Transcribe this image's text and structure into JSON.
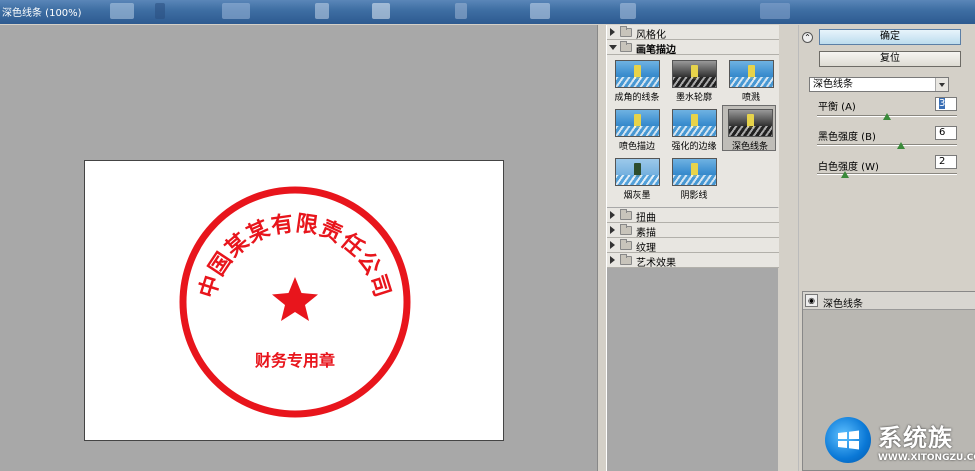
{
  "window": {
    "title": "深色线条 (100%)"
  },
  "gallery": {
    "categories_top": [
      {
        "label": "风格化",
        "expanded": false
      },
      {
        "label": "画笔描边",
        "expanded": true
      }
    ],
    "thumbnails": [
      {
        "label": "成角的线条",
        "selected": false
      },
      {
        "label": "墨水轮廓",
        "selected": false
      },
      {
        "label": "喷溅",
        "selected": false
      },
      {
        "label": "喷色描边",
        "selected": false
      },
      {
        "label": "强化的边缘",
        "selected": false
      },
      {
        "label": "深色线条",
        "selected": true
      },
      {
        "label": "烟灰墨",
        "selected": false
      },
      {
        "label": "阴影线",
        "selected": false
      }
    ],
    "categories_bottom": [
      {
        "label": "扭曲",
        "expanded": false
      },
      {
        "label": "素描",
        "expanded": false
      },
      {
        "label": "纹理",
        "expanded": false
      },
      {
        "label": "艺术效果",
        "expanded": false
      }
    ]
  },
  "panel": {
    "ok_label": "确定",
    "reset_label": "复位",
    "filter_select": "深色线条",
    "params": [
      {
        "label": "平衡 (A)",
        "value": "3",
        "level": 0.5,
        "min": 0,
        "max": 10
      },
      {
        "label": "黑色强度 (B)",
        "value": "6",
        "level": 0.6,
        "min": 0,
        "max": 10
      },
      {
        "label": "白色强度 (W)",
        "value": "2",
        "level": 0.2,
        "min": 0,
        "max": 10
      }
    ],
    "layer": {
      "name": "深色线条"
    }
  },
  "stamp": {
    "arc_text": "中国某某有限责任公司",
    "bottom_text": "财务专用章",
    "color": "#e8151c"
  },
  "watermark": {
    "brand": "系统族",
    "url": "WWW.XITONGZU.COM"
  },
  "colors": {
    "preview_bg": "#a8a8a8",
    "selected_thumb": "#bfbdb8",
    "accent": "#3a8a3a"
  }
}
